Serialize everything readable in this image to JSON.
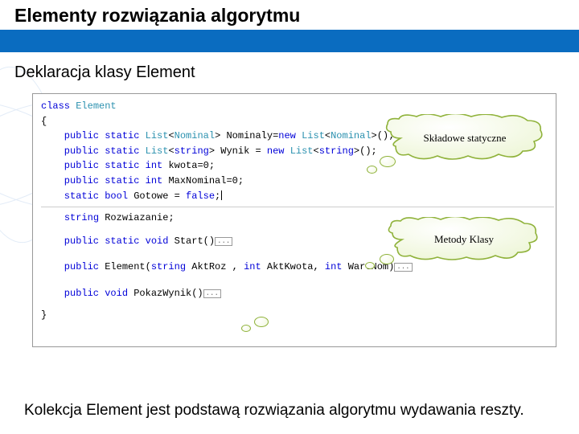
{
  "slide": {
    "title": "Elementy rozwiązania algorytmu",
    "section": "Deklaracja klasy Element",
    "bottom": "Kolekcja Element jest podstawą rozwiązania algorytmu wydawania reszty."
  },
  "callouts": {
    "static_members": "Składowe statyczne",
    "class_methods": "Metody Klasy"
  },
  "code": {
    "l1a": "class ",
    "l1b": "Element",
    "l2": "{",
    "l3a": "    public static ",
    "l3b": "List",
    "l3c": "<",
    "l3d": "Nominal",
    "l3e": "> Nominaly=",
    "l3f": "new ",
    "l3g": "List",
    "l3h": "<",
    "l3i": "Nominal",
    "l3j": ">();",
    "l4a": "    public static ",
    "l4b": "List",
    "l4c": "<",
    "l4d": "string",
    "l4e": "> Wynik = ",
    "l4f": "new ",
    "l4g": "List",
    "l4h": "<",
    "l4i": "string",
    "l4j": ">();",
    "l5a": "    public static int ",
    "l5b": "kwota=0;",
    "l6a": "    public static int ",
    "l6b": "MaxNominal=0;",
    "l7a": "    static bool ",
    "l7b": "Gotowe = ",
    "l7c": "false",
    "l7d": ";",
    "l8a": "    ",
    "l8b": "string",
    "l8c": " Rozwiazanie;",
    "l9a": "    public static void ",
    "l9b": "Start()",
    "l10a": "    public ",
    "l10b": "Element(",
    "l10c": "string",
    "l10d": " AktRoz , ",
    "l10e": "int",
    "l10f": " AktKwota, ",
    "l10g": "int",
    "l10h": " WartNom)",
    "l11a": "    public void ",
    "l11b": "PokazWynik()",
    "l12": "}",
    "ell": "..."
  }
}
